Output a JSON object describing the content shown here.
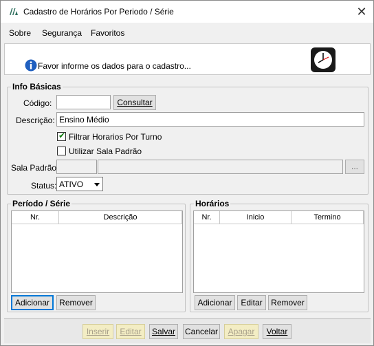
{
  "window": {
    "title": "Cadastro de Horários Por Periodo / Série",
    "close_glyph": "✕"
  },
  "menu": {
    "items": [
      "Sobre",
      "Segurança",
      "Favoritos"
    ]
  },
  "info": {
    "message": "Favor informe os dados para o cadastro...",
    "icon": "info-icon",
    "clock_icon": "clock-icon"
  },
  "basic": {
    "legend": "Info Básicas",
    "codigo_label": "Código:",
    "codigo_value": "",
    "consultar_label": "Consultar",
    "descricao_label": "Descrição:",
    "descricao_value": "Ensino Médio",
    "filtrar_label": "Filtrar Horarios Por Turno",
    "filtrar_checked": true,
    "utilizar_label": "Utilizar Sala Padrão",
    "utilizar_checked": false,
    "sala_label": "Sala Padrão:",
    "sala_code": "",
    "sala_name": "",
    "browse_label": "...",
    "status_label": "Status:",
    "status_value": "ATIVO"
  },
  "periodo": {
    "legend": "Período / Série",
    "columns": [
      "Nr.",
      "Descrição"
    ],
    "rows": [],
    "add_label": "Adicionar",
    "remove_label": "Remover"
  },
  "horarios": {
    "legend": "Horários",
    "columns": [
      "Nr.",
      "Inicio",
      "Termino"
    ],
    "rows": [],
    "add_label": "Adicionar",
    "edit_label": "Editar",
    "remove_label": "Remover"
  },
  "footer": {
    "inserir": "Inserir",
    "editar": "Editar",
    "salvar": "Salvar",
    "cancelar": "Cancelar",
    "apagar": "Apagar",
    "voltar": "Voltar"
  }
}
